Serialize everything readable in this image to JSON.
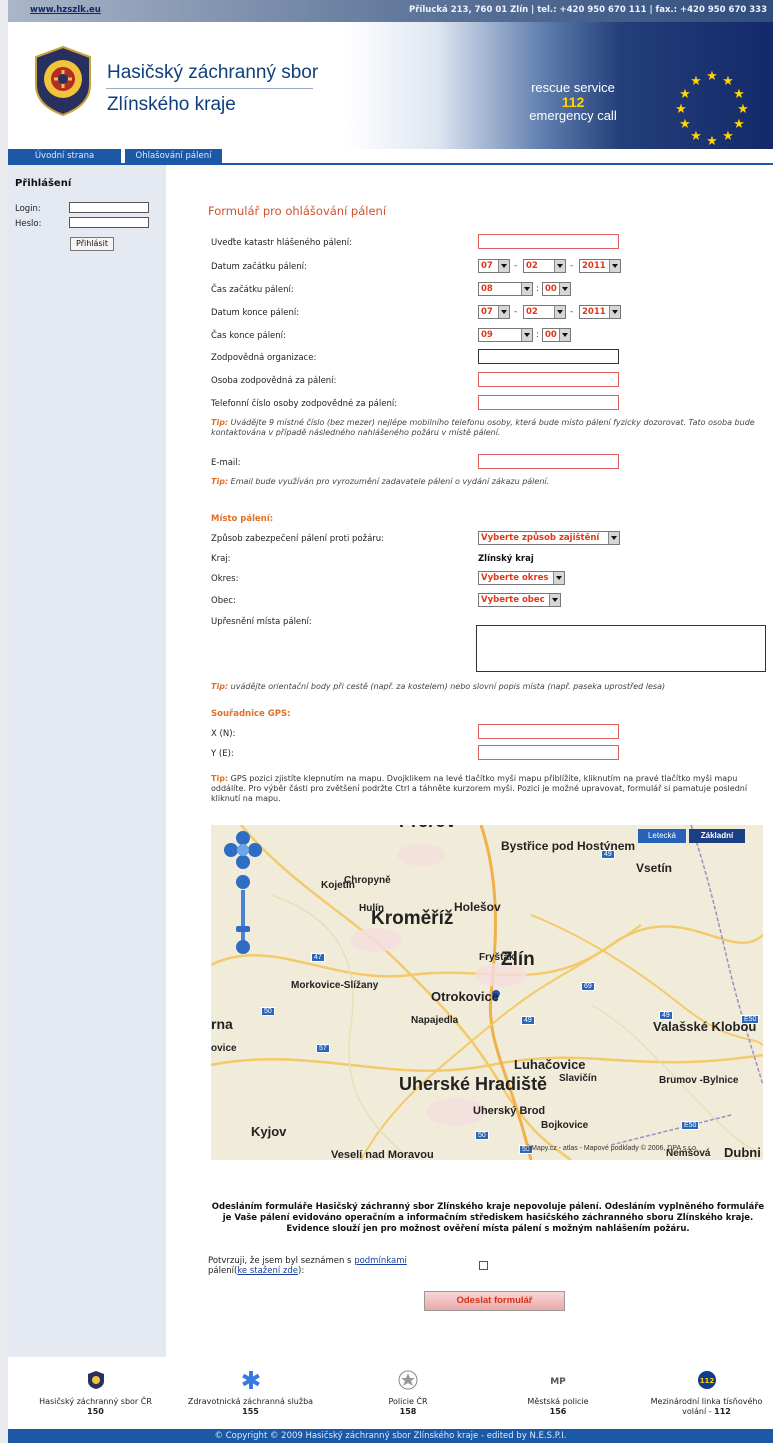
{
  "topbar": {
    "site": "www.hzszlk.eu",
    "address": "Přílucká 213, 760 01 Zlín | tel.: +420 950 670 111 | fax.: +420 950 670 333"
  },
  "header": {
    "title_line1": "Hasičský záchranný sbor",
    "title_line2": "Zlínského kraje",
    "rescue_line1": "rescue service",
    "rescue_number": "112",
    "rescue_line2": "emergency call"
  },
  "nav": {
    "home": "Úvodní strana",
    "burning": "Ohlašování pálení"
  },
  "login": {
    "title": "Přihlášení",
    "login_label": "Login:",
    "password_label": "Heslo:",
    "button": "Přihlásit"
  },
  "form": {
    "title": "Formulář pro ohlášování pálení",
    "cadastre_label": "Uveďte katastr hlášeného pálení:",
    "start_date_label": "Datum začátku pálení:",
    "start_time_label": "Čas začátku pálení:",
    "end_date_label": "Datum konce pálení:",
    "end_time_label": "Čas konce pálení:",
    "organization_label": "Zodpovědná organizace:",
    "person_label": "Osoba zodpovědná za pálení:",
    "phone_label": "Telefonní číslo osoby zodpovědné za pálení:",
    "start_day": "07",
    "start_month": "02",
    "start_year": "2011",
    "start_hour": "08",
    "start_min": "00",
    "end_day": "07",
    "end_month": "02",
    "end_year": "2011",
    "end_hour": "09",
    "end_min": "00",
    "date_sep": "-",
    "time_sep": ":",
    "phone_tip_label": "Tip:",
    "phone_tip": "Uvádějte 9 místné číslo (bez mezer) nejlépe mobilního telefonu osoby, která bude místo pálení fyzicky dozorovat. Tato osoba bude kontaktována v případě následného nahlášeného požáru v místě pálení.",
    "email_label": "E-mail:",
    "email_tip_label": "Tip:",
    "email_tip": "Email bude využíván pro vyrozumění zadavatele pálení o vydání zákazu pálení.",
    "place_section": "Místo pálení:",
    "security_label": "Způsob zabezpečení pálení proti požáru:",
    "security_value": "Vyberte způsob zajištění",
    "region_label": "Kraj:",
    "region_value": "Zlínský kraj",
    "district_label": "Okres:",
    "district_value": "Vyberte okres",
    "municipality_label": "Obec:",
    "municipality_value": "Vyberte obec",
    "place_detail_label": "Upřesnění místa pálení:",
    "place_tip_label": "Tip:",
    "place_tip": "uvádějte orientační body při cestě (např. za kostelem) nebo slovní popis místa (např. paseka uprostřed lesa)",
    "gps_section": "Souřadnice GPS:",
    "gps_x_label": "X (N):",
    "gps_y_label": "Y (E):",
    "gps_tip_label": "Tip:",
    "gps_tip": "GPS pozici zjistíte klepnutím na mapu. Dvojklikem na levé tlačítko myši mapu přiblížíte, kliknutím na pravé tlačítko myši mapu oddálíte. Pro výběr části pro zvětšení podržte Ctrl a táhněte kurzorem myši. Pozici je možné upravovat, formulář si pamatuje poslední kliknutí na mapu."
  },
  "map": {
    "btn_aerial": "Letecká",
    "btn_basic": "Základní",
    "cities": [
      "Přerov",
      "Bystřice pod Hostýnem",
      "Vsetín",
      "Kojetín",
      "Chropyně",
      "Hulín",
      "Holešov",
      "Kroměříž",
      "Fryšták",
      "Zlín",
      "Morkovice-Slížany",
      "Otrokovice",
      "Napajedla",
      "Valašské Klobou",
      "Luhačovice",
      "Slavičín",
      "Brumov -Bylnice",
      "Uherské Hradiště",
      "Uherský Brod",
      "Bojkovice",
      "Kyjov",
      "Nemšová",
      "Dubni",
      "rna",
      "ovice",
      "Veselí nad Moravou"
    ],
    "roads": [
      "47",
      "49",
      "69",
      "49",
      "49",
      "E50",
      "50",
      "57",
      "E50",
      "50",
      "55"
    ],
    "attribution": "©Mapy.cz - atlas - Mapové podklady © 2006, DPA s.r.o."
  },
  "disclaimer": "Odesláním formuláře Hasičský záchranný sbor Zlínského kraje nepovoluje pálení. Odesláním vyplněného formuláře je Vaše pálení evidováno operačním a informačním střediskem hasičského záchranného sboru Zlínského kraje. Evidence slouží jen pro možnost ověření místa pálení s možným nahlášením požáru.",
  "confirm": {
    "text1": "Potvrzuji, že jsem byl seznámen s",
    "link1": "podmínkami",
    "text2": "pálení(",
    "link2": "ke stažení zde",
    "text3": "):"
  },
  "submit": "Odeslat formulář",
  "footer": [
    {
      "name": "Hasičský záchranný sbor ČR",
      "number": "150",
      "icon": "firefighter-badge-icon"
    },
    {
      "name": "Zdravotnická záchranná služba",
      "number": "155",
      "icon": "star-of-life-icon"
    },
    {
      "name": "Policie ČR",
      "number": "158",
      "icon": "police-badge-icon"
    },
    {
      "name": "Městská policie",
      "number": "156",
      "icon": "municipal-police-icon"
    },
    {
      "name": "Mezinárodní linka tísňového volání -",
      "number": "112",
      "icon": "112-emergency-icon"
    }
  ],
  "copyright": "© Copyright © 2009 Hasičský záchranný sbor Zlínského kraje - edited by N.E.S.P.I."
}
